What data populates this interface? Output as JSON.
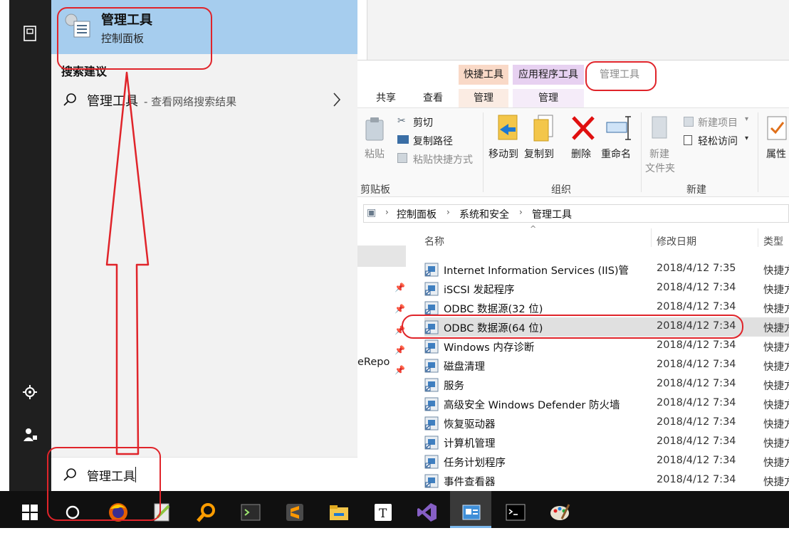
{
  "start_menu": {
    "best_match": {
      "title": "管理工具",
      "subtitle": "控制面板",
      "icon": "control-panel-icon"
    },
    "section_label": "搜索建议",
    "suggestion": {
      "title": "管理工具",
      "subtitle": "- 查看网络搜索结果",
      "icon": "search-icon"
    },
    "search_query": "管理工具",
    "rail_icons": [
      "book-icon",
      "gear-icon",
      "person-icon"
    ]
  },
  "explorer": {
    "context_tabs": [
      "快捷工具",
      "应用程序工具",
      "管理工具"
    ],
    "ribbon_tabs": [
      "共享",
      "查看",
      "管理",
      "管理"
    ],
    "ribbon": {
      "clipboard": {
        "paste": "粘贴",
        "cut": "剪切",
        "copy_path": "复制路径",
        "paste_shortcut": "粘贴快捷方式",
        "label": "剪贴板"
      },
      "organize": {
        "move_to": "移动到",
        "copy_to": "复制到",
        "delete": "删除",
        "rename": "重命名",
        "label": "组织"
      },
      "new": {
        "new_folder_1": "新建",
        "new_folder_2": "文件夹",
        "new_item": "新建项目",
        "easy_access": "轻松访问",
        "label": "新建"
      },
      "open": {
        "properties": "属性"
      }
    },
    "breadcrumb": [
      "控制面板",
      "系统和安全",
      "管理工具"
    ],
    "nav_partial_text": "eRepo",
    "columns": {
      "name": "名称",
      "date": "修改日期",
      "type": "类型"
    },
    "files": [
      {
        "name": "Internet Information Services (IIS)管",
        "date": "2018/4/12 7:35",
        "type": "快捷方"
      },
      {
        "name": "iSCSI 发起程序",
        "date": "2018/4/12 7:34",
        "type": "快捷方"
      },
      {
        "name": "ODBC 数据源(32 位)",
        "date": "2018/4/12 7:34",
        "type": "快捷方"
      },
      {
        "name": "ODBC 数据源(64 位)",
        "date": "2018/4/12 7:34",
        "type": "快捷方"
      },
      {
        "name": "Windows 内存诊断",
        "date": "2018/4/12 7:34",
        "type": "快捷方"
      },
      {
        "name": "磁盘清理",
        "date": "2018/4/12 7:34",
        "type": "快捷方"
      },
      {
        "name": "服务",
        "date": "2018/4/12 7:34",
        "type": "快捷方"
      },
      {
        "name": "高级安全 Windows Defender 防火墙",
        "date": "2018/4/12 7:34",
        "type": "快捷方"
      },
      {
        "name": "恢复驱动器",
        "date": "2018/4/12 7:34",
        "type": "快捷方"
      },
      {
        "name": "计算机管理",
        "date": "2018/4/12 7:34",
        "type": "快捷方"
      },
      {
        "name": "任务计划程序",
        "date": "2018/4/12 7:34",
        "type": "快捷方"
      },
      {
        "name": "事件查看器",
        "date": "2018/4/12 7:34",
        "type": "快捷方"
      }
    ],
    "selected_index": 3
  },
  "taskbar": {
    "icons": [
      "windows-start-icon",
      "cortana-circle-icon",
      "firefox-icon",
      "notepad-plus-icon",
      "search-magnifier-app-icon",
      "terminal-app-icon",
      "sublime-text-icon",
      "file-explorer-icon",
      "typora-icon",
      "visual-studio-icon",
      "control-panel-app-icon",
      "cmd-icon",
      "paint-icon"
    ]
  },
  "colors": {
    "best_match_bg": "#a6cdee",
    "annotation_red": "#e0242a",
    "ctx_quick_bg": "#f9d9c7",
    "ctx_app_bg": "#e7d1f1"
  }
}
